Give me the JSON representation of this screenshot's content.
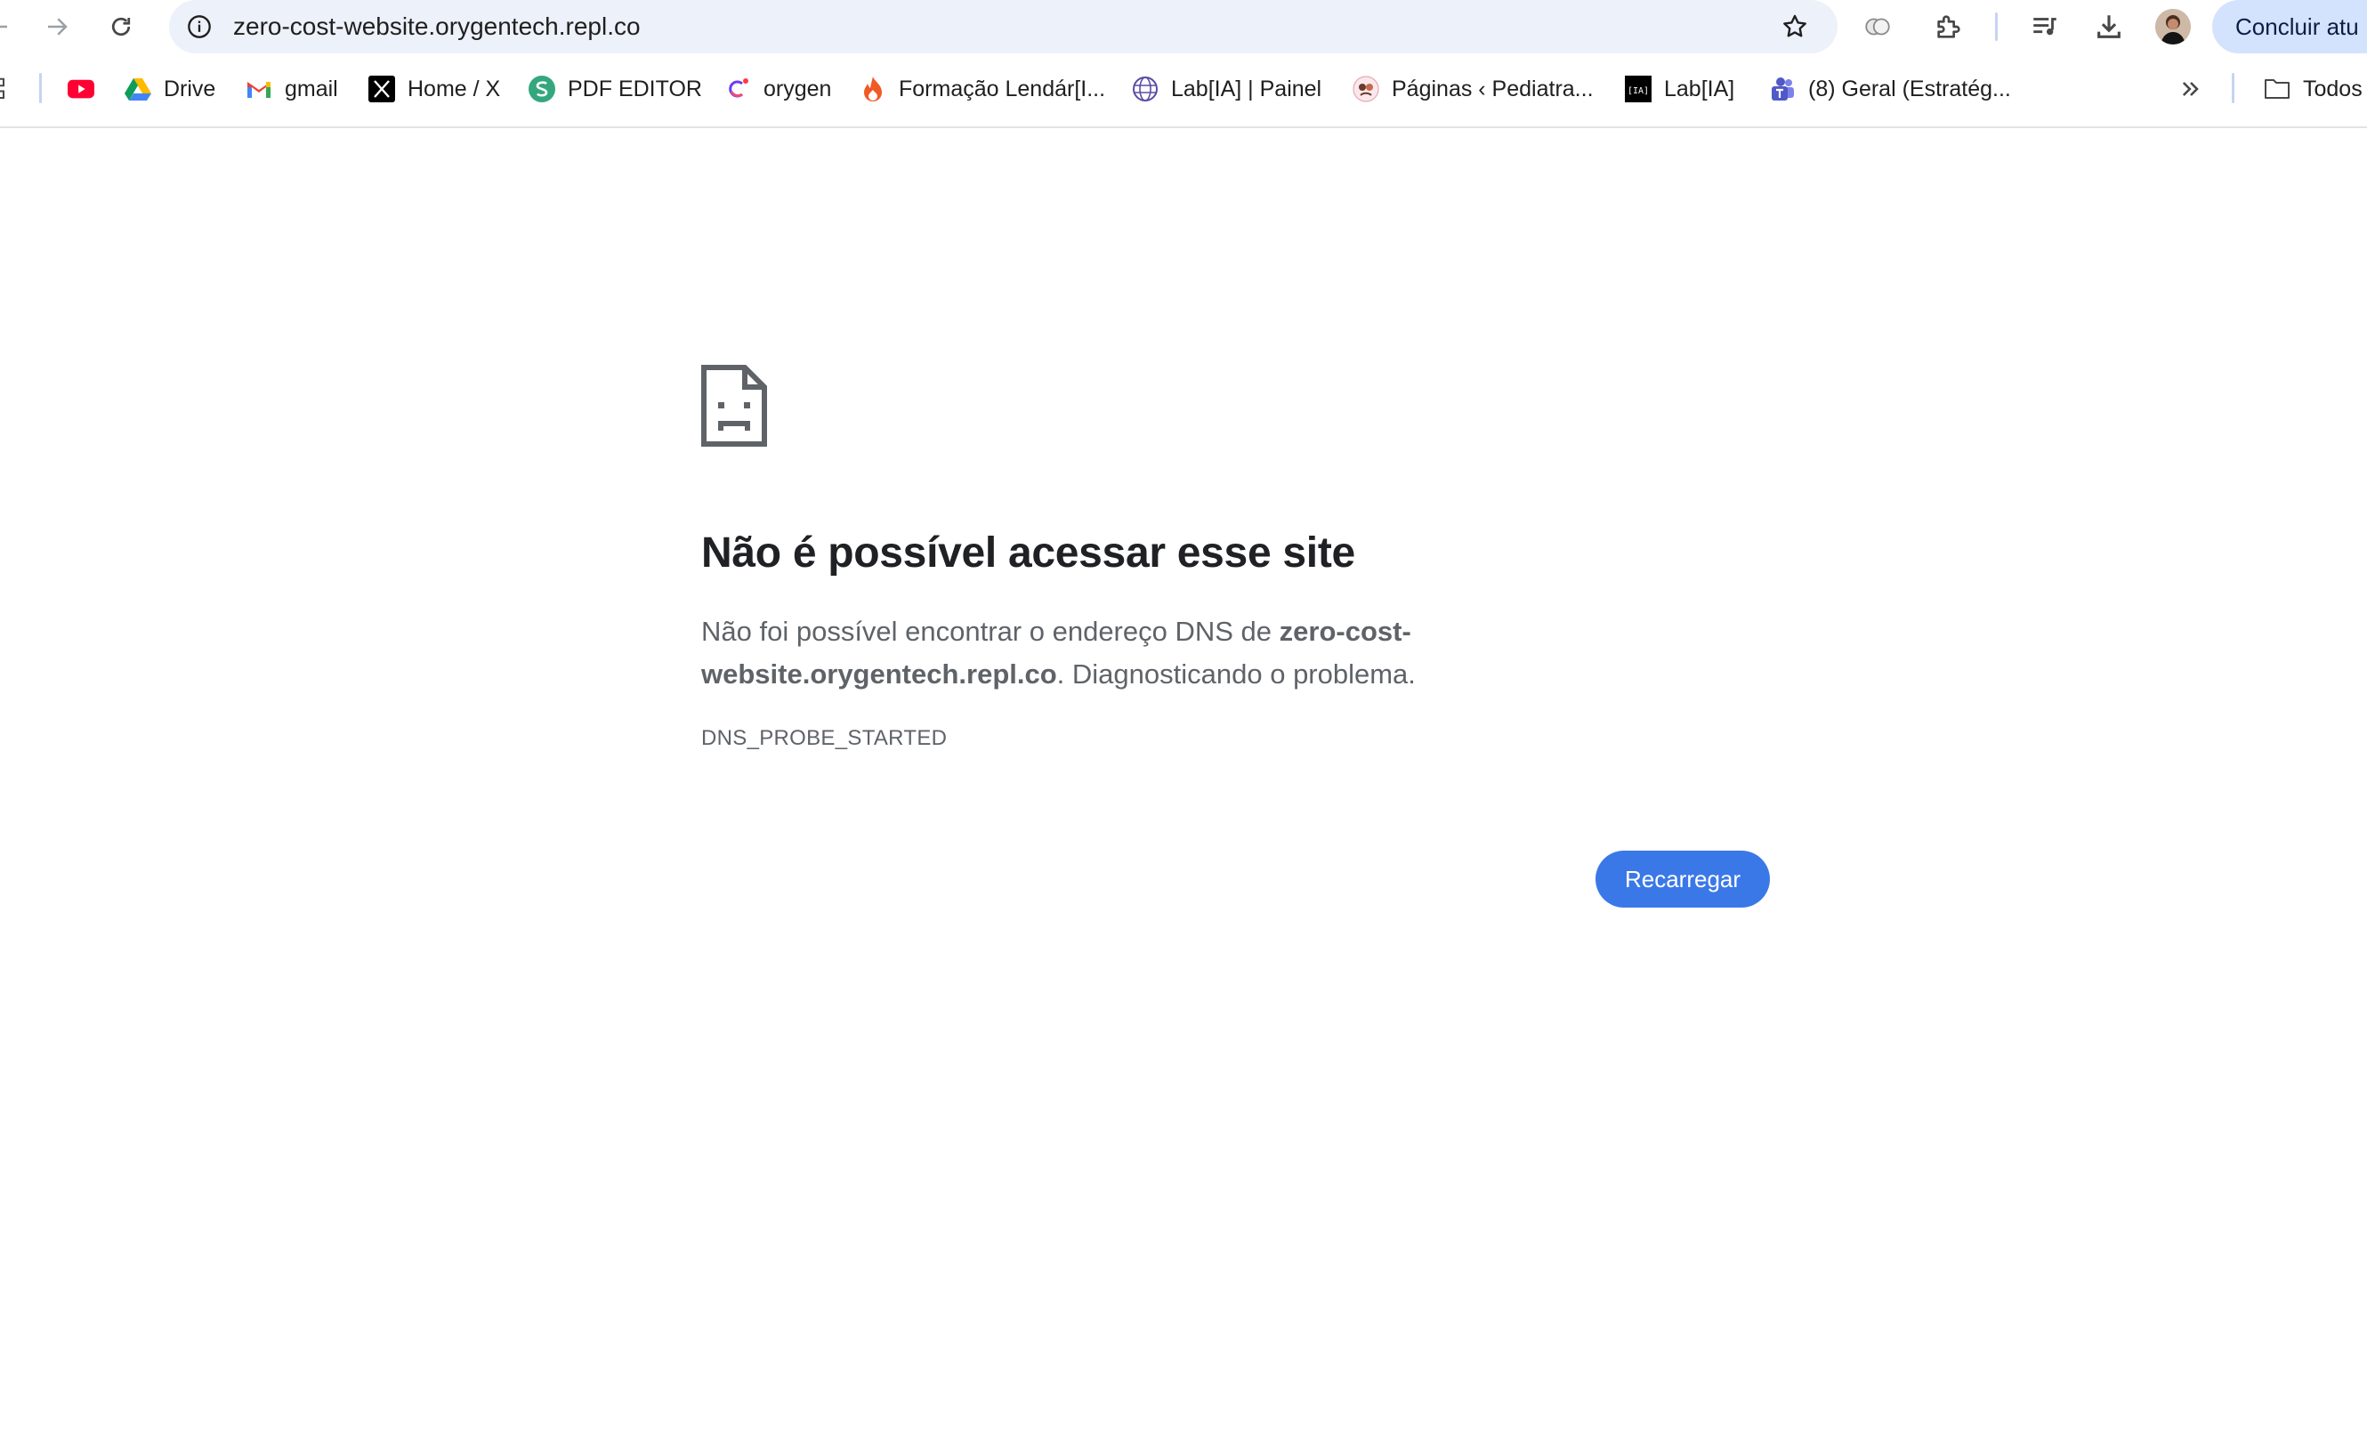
{
  "colors": {
    "omnibox_bg": "#edf1f9",
    "update_bg": "#d3e3fd",
    "reload_bg": "#3b78e7",
    "title_text": "#202124",
    "body_text": "#5f6368"
  },
  "toolbar": {
    "back_icon": "back-arrow-icon",
    "forward_icon": "forward-arrow-icon",
    "reload_icon": "reload-icon",
    "url": "zero-cost-website.orygentech.repl.co",
    "site_info_icon": "info-icon",
    "bookmark_icon": "star-icon",
    "update_label": "Concluir atu"
  },
  "bookmarks": {
    "items": [
      {
        "label": "",
        "icon": "youtube-icon"
      },
      {
        "label": "Drive",
        "icon": "google-drive-icon"
      },
      {
        "label": "gmail",
        "icon": "gmail-icon"
      },
      {
        "label": "Home / X",
        "icon": "x-icon"
      },
      {
        "label": "PDF EDITOR",
        "icon": "pdf-editor-icon"
      },
      {
        "label": "orygen",
        "icon": "orygen-icon"
      },
      {
        "label": "Formação Lendár[I...",
        "icon": "fire-icon"
      },
      {
        "label": "Lab[IA] | Painel",
        "icon": "globe-icon"
      },
      {
        "label": "Páginas ‹ Pediatra...",
        "icon": "pediatra-icon"
      },
      {
        "label": "Lab[IA]",
        "icon": "labia-icon"
      },
      {
        "label": "(8) Geral (Estratég...",
        "icon": "teams-icon"
      }
    ],
    "overflow_icon": "chevrons-right-icon",
    "all_bookmarks_label": "Todos"
  },
  "error": {
    "icon": "sad-page-icon",
    "title": "Não é possível acessar esse site",
    "message_prefix": "Não foi possível encontrar o endereço DNS de ",
    "message_host": "zero-cost-website.orygentech.repl.co",
    "message_suffix": ". Diagnosticando o problema.",
    "code": "DNS_PROBE_STARTED",
    "reload_label": "Recarregar"
  }
}
